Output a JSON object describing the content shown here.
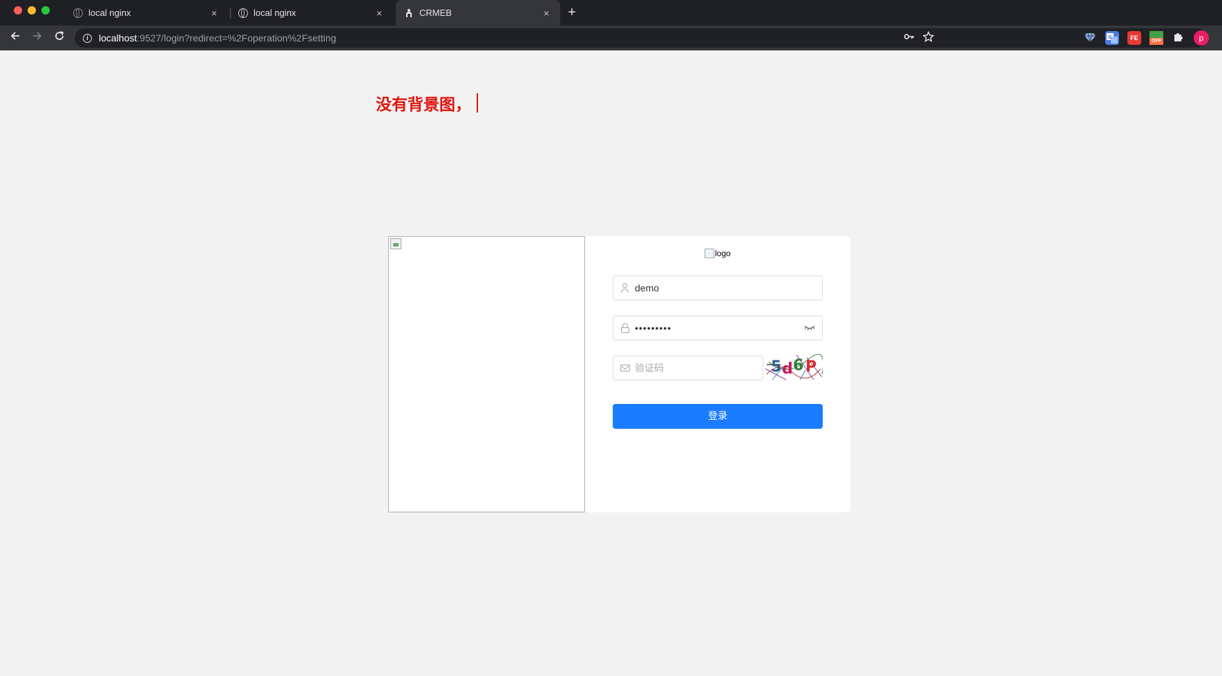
{
  "browser": {
    "tabs": [
      {
        "title": "local nginx",
        "active": false,
        "icon": "globe-icon"
      },
      {
        "title": "local nginx",
        "active": false,
        "icon": "globe-icon"
      },
      {
        "title": "CRMEB",
        "active": true,
        "icon": "crmeb-icon"
      }
    ],
    "new_tab_symbol": "+",
    "close_symbol": "×",
    "url_host": "localhost",
    "url_rest": ":9527/login?redirect=%2Foperation%2Fsetting",
    "avatar_letter": "p",
    "extensions": {
      "fe_label": "FE",
      "off_label": "OFF"
    }
  },
  "annotation": {
    "text": "没有背景图，",
    "color": "#e0140f"
  },
  "login": {
    "logo_alt": "logo",
    "username": {
      "value": "demo",
      "icon": "user-icon"
    },
    "password": {
      "value": "•••••••••",
      "icon": "lock-icon"
    },
    "captcha": {
      "placeholder": "验证码",
      "icon": "mail-icon",
      "image_text": "5d6P"
    },
    "submit_label": "登录",
    "accent_color": "#1a7cff"
  }
}
